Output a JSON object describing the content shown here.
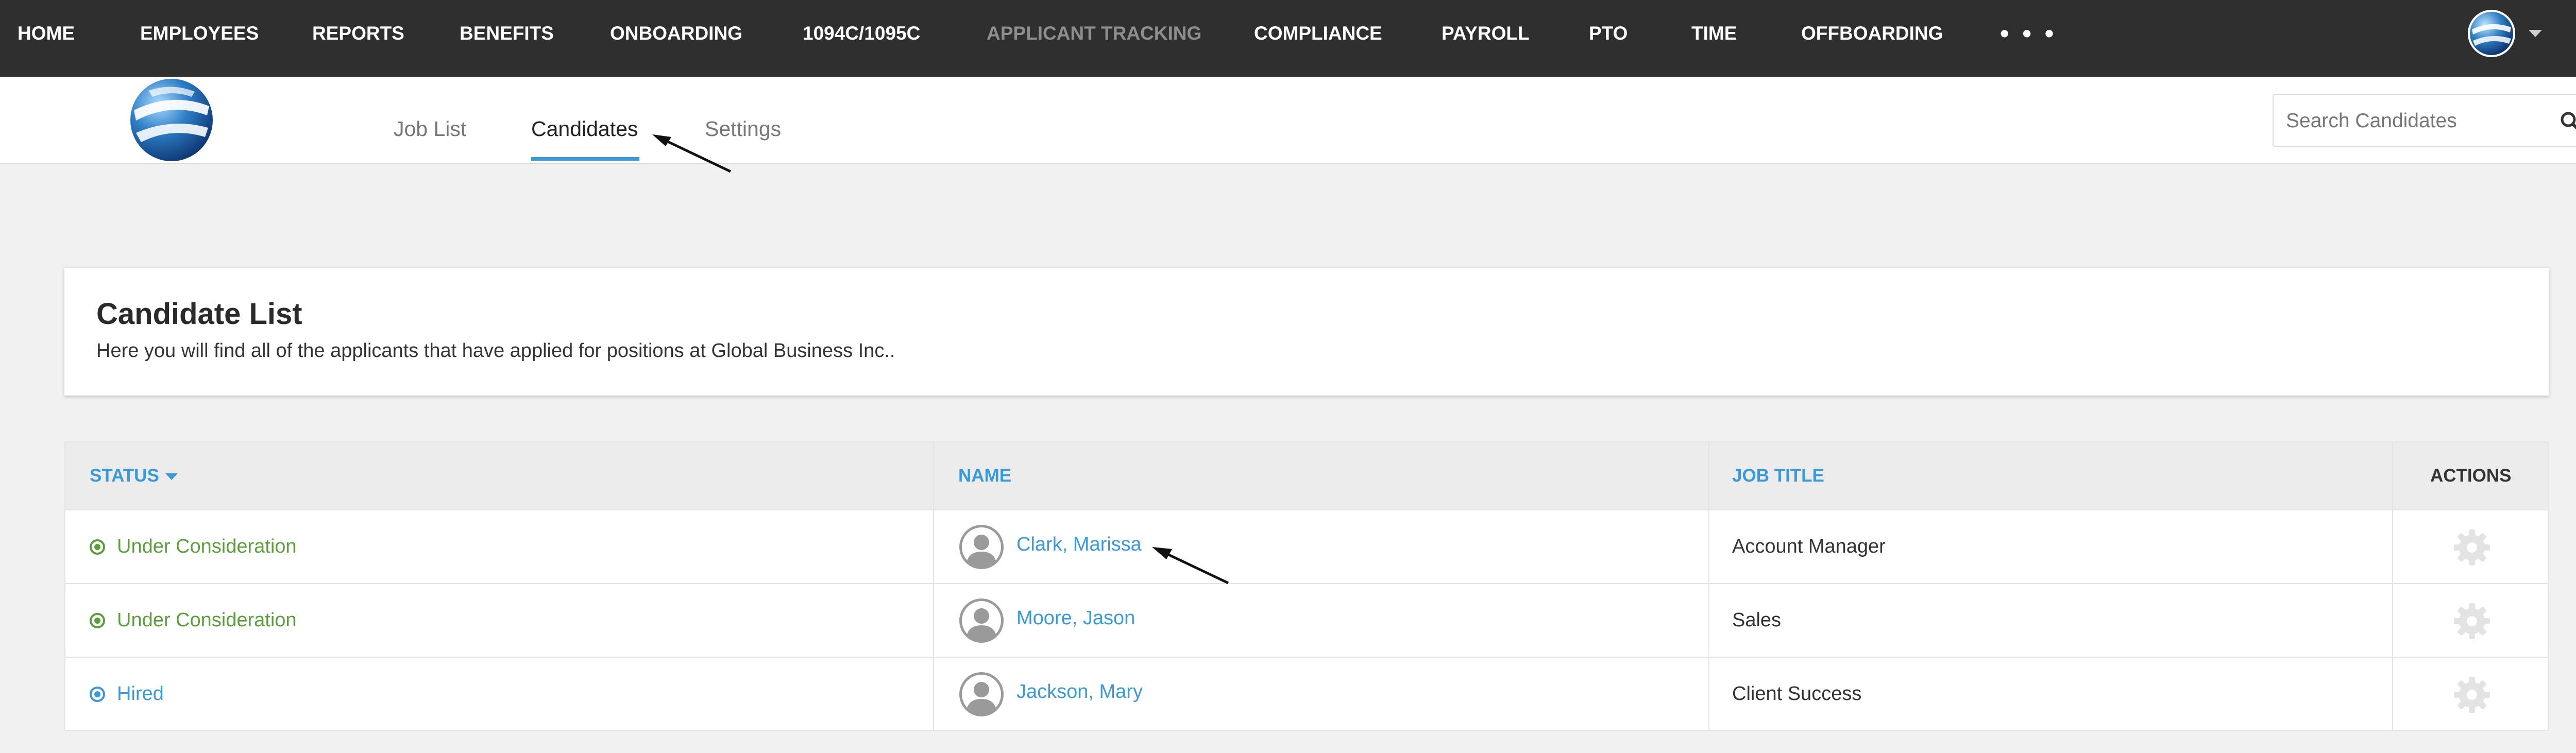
{
  "topnav": {
    "items": [
      {
        "label": "HOME"
      },
      {
        "label": "EMPLOYEES"
      },
      {
        "label": "REPORTS"
      },
      {
        "label": "BENEFITS"
      },
      {
        "label": "ONBOARDING"
      },
      {
        "label": "1094C/1095C"
      },
      {
        "label": "APPLICANT TRACKING"
      },
      {
        "label": "COMPLIANCE"
      },
      {
        "label": "PAYROLL"
      },
      {
        "label": "PTO"
      },
      {
        "label": "TIME"
      },
      {
        "label": "OFFBOARDING"
      }
    ],
    "active": "APPLICANT TRACKING",
    "more_label": "• • •"
  },
  "subnav": {
    "tabs": [
      {
        "label": "Job List"
      },
      {
        "label": "Candidates"
      },
      {
        "label": "Settings"
      }
    ],
    "active_tab": "Candidates"
  },
  "search": {
    "placeholder": "Search Candidates",
    "value": ""
  },
  "card": {
    "title": "Candidate List",
    "description": "Here you will find all of the applicants that have applied for positions at Global Business Inc.."
  },
  "table": {
    "headers": {
      "status": "STATUS",
      "name": "NAME",
      "job_title": "JOB TITLE",
      "actions": "ACTIONS"
    },
    "rows": [
      {
        "status": "Under Consideration",
        "name": "Clark, Marissa",
        "job_title": "Account Manager"
      },
      {
        "status": "Under Consideration",
        "name": "Moore, Jason",
        "job_title": "Sales"
      },
      {
        "status": "Hired",
        "name": "Jackson, Mary",
        "job_title": "Client Success"
      }
    ]
  },
  "colors": {
    "topnav_bg": "#2f2f2f",
    "accent_blue": "#3a9ad9",
    "status_green": "#5c9e3c",
    "page_bg": "#f1f1f1"
  },
  "icons": [
    "globe-logo-icon",
    "avatar-icon",
    "chevron-down-icon",
    "trash-icon",
    "search-icon",
    "status-radio-icon",
    "person-icon",
    "gear-icon",
    "annotation-arrow"
  ]
}
